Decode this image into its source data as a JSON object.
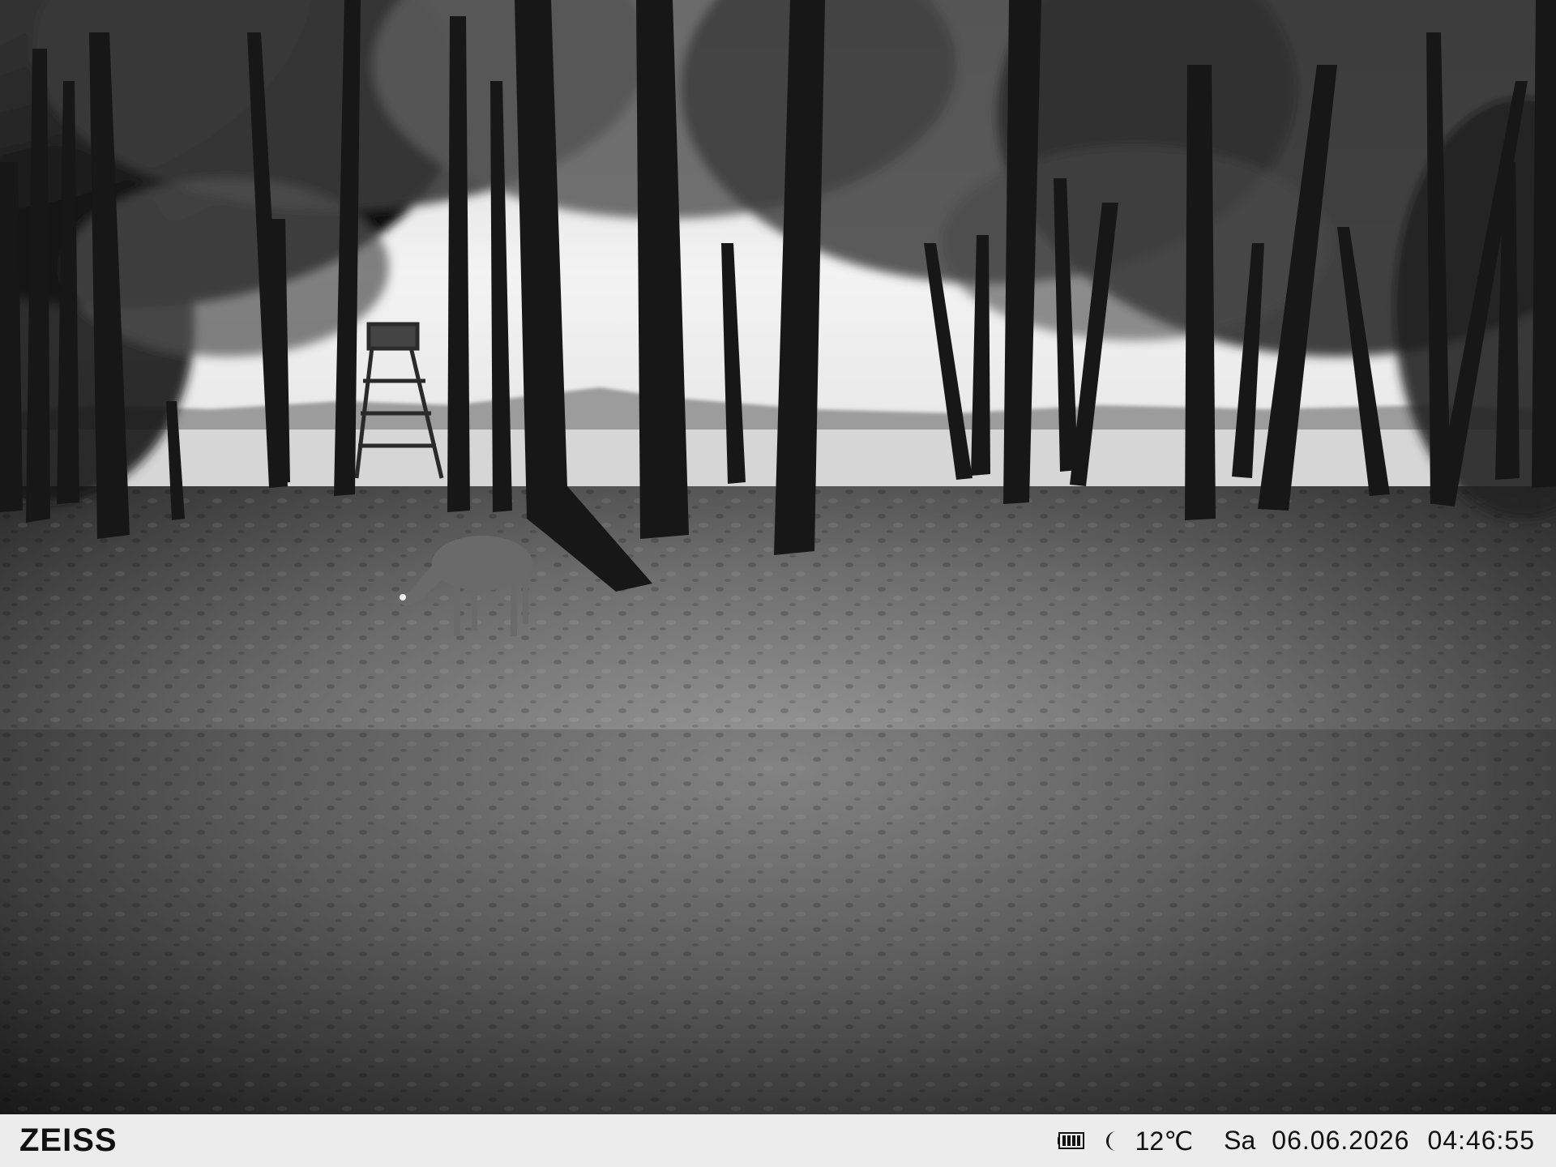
{
  "camera": {
    "brand": "ZEISS",
    "temperature": "12℃",
    "weekday": "Sa",
    "date": "06.06.2026",
    "time": "04:46:55",
    "icons": {
      "battery": "battery-icon",
      "night_mode": "moon-icon"
    }
  },
  "scene": {
    "mode": "infrared-night",
    "colors": {
      "sky": "#f1f1f1",
      "field": "#d9d9d9",
      "ground": "#4a4a4a",
      "trunk": "#181818",
      "bar": "#ececec"
    }
  }
}
